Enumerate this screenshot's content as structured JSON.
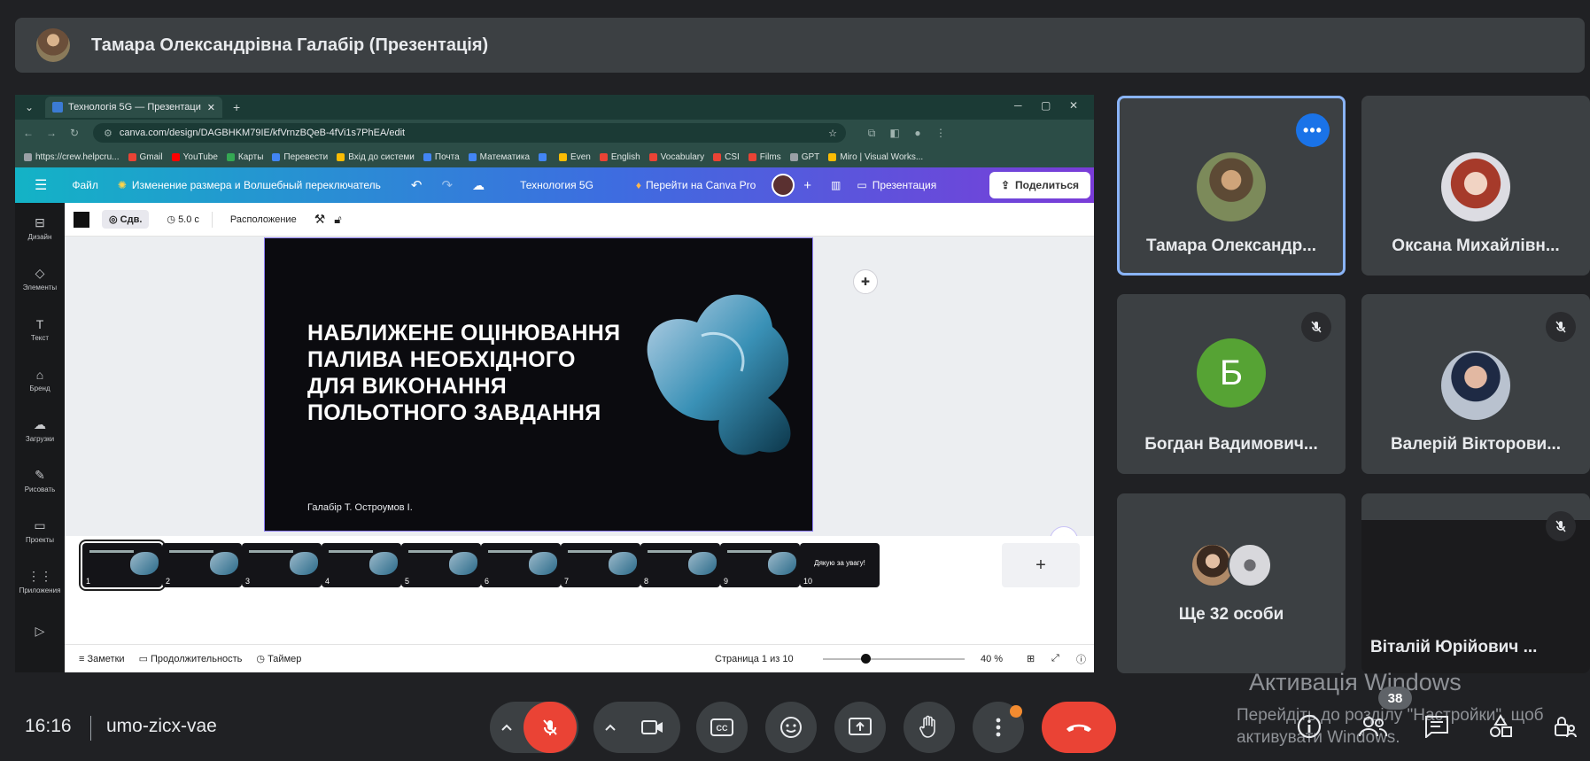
{
  "presenter_bar": {
    "title": "Тамара Олександрівна Галабір (Презентація)"
  },
  "browser": {
    "tab_title": "Технологія 5G — Презентаци",
    "new_tab": "+",
    "url": "canva.com/design/DAGBHKM79IE/kfVrnzBQeB-4fVi1s7PhEA/edit",
    "bookmarks": [
      {
        "label": "https://crew.helpcru...",
        "color": "#9aa0a6"
      },
      {
        "label": "Gmail",
        "color": "#ea4335"
      },
      {
        "label": "YouTube",
        "color": "#ff0000"
      },
      {
        "label": "Карты",
        "color": "#34a853"
      },
      {
        "label": "Перевести",
        "color": "#4285f4"
      },
      {
        "label": "Вхід до системи",
        "color": "#fbbc04"
      },
      {
        "label": "Почта",
        "color": "#4285f4"
      },
      {
        "label": "Математика",
        "color": "#4285f4"
      },
      {
        "label": "",
        "color": "#4285f4"
      },
      {
        "label": "Even",
        "color": "#fbbc04"
      },
      {
        "label": "English",
        "color": "#ea4335"
      },
      {
        "label": "Vocabulary",
        "color": "#ea4335"
      },
      {
        "label": "CSI",
        "color": "#ea4335"
      },
      {
        "label": "Films",
        "color": "#ea4335"
      },
      {
        "label": "GPT",
        "color": "#9aa0a6"
      },
      {
        "label": "Miro | Visual Works...",
        "color": "#fbbc04"
      }
    ]
  },
  "canva": {
    "header": {
      "file": "Файл",
      "resize": "Изменение размера и Волшебный переключатель",
      "doc_title": "Технология 5G",
      "pro": "Перейти на Canva Pro",
      "present": "Презентация",
      "share": "Поделиться"
    },
    "rail": [
      {
        "icon": "⊟",
        "label": "Дизайн"
      },
      {
        "icon": "◇",
        "label": "Элементы"
      },
      {
        "icon": "T",
        "label": "Текст"
      },
      {
        "icon": "⌂",
        "label": "Бренд"
      },
      {
        "icon": "☁",
        "label": "Загрузки"
      },
      {
        "icon": "✎",
        "label": "Рисовать"
      },
      {
        "icon": "▭",
        "label": "Проекты"
      },
      {
        "icon": "⋮⋮",
        "label": "Приложения"
      },
      {
        "icon": "▷",
        "label": ""
      }
    ],
    "toolbar": {
      "sdv": "Сдв.",
      "duration": "5.0 с",
      "arrange": "Расположение"
    },
    "slide": {
      "title_lines": [
        "НАБЛИЖЕНЕ ОЦІНЮВАННЯ",
        "ПАЛИВА НЕОБХІДНОГО",
        "ДЛЯ ВИКОНАННЯ",
        "ПОЛЬОТНОГО ЗАВДАННЯ"
      ],
      "authors": "Галабір Т. Остроумов І."
    },
    "thumbnails": [
      "1",
      "2",
      "3",
      "4",
      "5",
      "6",
      "7",
      "8",
      "9",
      "10"
    ],
    "thumb_10_text": "Дякую за увагу!",
    "footer": {
      "notes": "Заметки",
      "duration": "Продолжительность",
      "timer": "Таймер",
      "page": "Страница 1 из 10",
      "zoom": "40 %",
      "zoom_fraction": 0.3
    }
  },
  "participants": [
    {
      "name": "Тамара Олександр..."
    },
    {
      "name": "Оксана Михайлівн..."
    },
    {
      "name": "Богдан Вадимович...",
      "initial": "Б"
    },
    {
      "name": "Валерій Вікторови..."
    },
    {
      "name": "Ще 32 особи"
    },
    {
      "name": "Віталій Юрійович ..."
    }
  ],
  "bottom_bar": {
    "time": "16:16",
    "meeting_code": "umo-zicx-vae",
    "people_count": "38"
  },
  "watermark": {
    "title": "Активація Windows",
    "subtitle": "Перейдіть до розділу \"Настройки\", щоб активувати Windows."
  },
  "colors": {
    "accent_blue": "#1a73e8",
    "danger_red": "#ea4335",
    "tile_bg": "#3c4043",
    "page_bg": "#202124"
  }
}
